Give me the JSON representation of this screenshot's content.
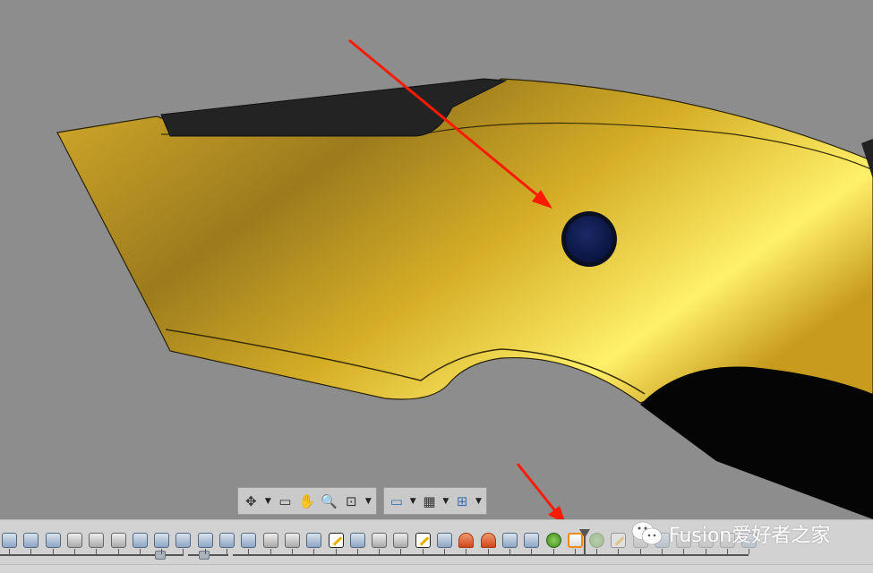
{
  "viewport": {
    "background_color": "#8d8d8d",
    "body_color": "#c9a224",
    "grip_color": "#1e1e1e",
    "button_color": "#0e1b4f",
    "arrow_color": "#ff1a00"
  },
  "nav_toolbar": {
    "left_group": [
      "orbit-icon",
      "look-at-icon",
      "pan-icon",
      "zoom-icon",
      "fit-icon"
    ],
    "right_group": [
      "display-settings-icon",
      "grid-settings-icon",
      "viewports-icon"
    ]
  },
  "timeline": {
    "icons": [
      "joint-origin",
      "combine",
      "combine",
      "fillet",
      "shell",
      "shell",
      "split-body",
      "move",
      "move",
      "move",
      "move",
      "revolve",
      "chamfer",
      "box",
      "extrude",
      "sketch",
      "sweep",
      "box",
      "chamfer",
      "sketch",
      "sweep",
      "pin",
      "pin",
      "loft",
      "loft",
      "green-joint",
      "orange-edit",
      "green-joint",
      "sketch",
      "box",
      "extrude",
      "chamfer",
      "shell",
      "shell",
      "joint"
    ],
    "marker_index": 27
  },
  "watermark": {
    "text": "Fusion爱好者之家"
  }
}
